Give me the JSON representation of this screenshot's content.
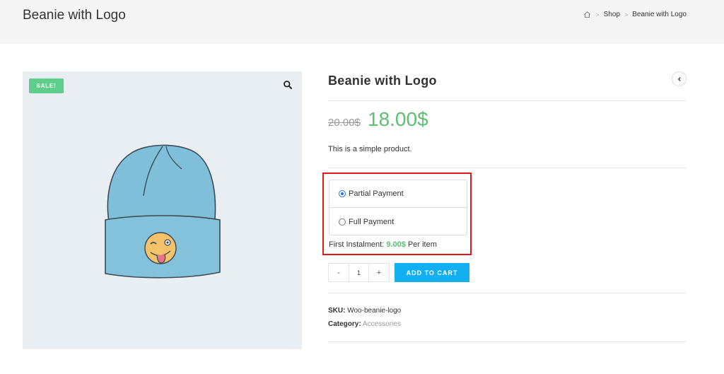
{
  "header": {
    "title": "Beanie with Logo",
    "breadcrumb": {
      "home_icon": "home-icon",
      "items": [
        "Shop",
        "Beanie with Logo"
      ],
      "separator": ">"
    }
  },
  "gallery": {
    "sale_badge": "SALE!",
    "zoom_icon": "search-icon",
    "image": "beanie-with-smiley-logo"
  },
  "product": {
    "title": "Beanie with Logo",
    "nav_icon": "chevron-left-icon",
    "price_old": "20.00$",
    "price_new": "18.00$",
    "short_description": "This is a simple product.",
    "payment": {
      "options": [
        {
          "label": "Partial Payment",
          "checked": true
        },
        {
          "label": "Full Payment",
          "checked": false
        }
      ],
      "instalment_prefix": "First Instalment:",
      "instalment_amount": "9.00$",
      "instalment_suffix": "Per item"
    },
    "quantity": {
      "minus": "-",
      "value": "1",
      "plus": "+"
    },
    "add_to_cart": "ADD TO CART",
    "sku_label": "SKU:",
    "sku_value": "Woo-beanie-logo",
    "category_label": "Category:",
    "category_value": "Accessories"
  },
  "colors": {
    "price_green": "#5fbd74",
    "sale_badge": "#5fcd8c",
    "cart_button": "#13aff0",
    "highlight_border": "#e0191b"
  }
}
